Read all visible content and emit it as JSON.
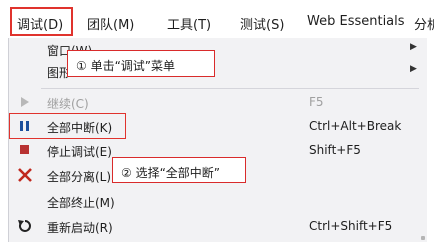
{
  "menubar": {
    "items": [
      {
        "label": "调试(D)"
      },
      {
        "label": "团队(M)"
      },
      {
        "label": "工具(T)"
      },
      {
        "label": "测试(S)"
      },
      {
        "label": "Web Essentials"
      },
      {
        "label": "分析"
      }
    ]
  },
  "menu": {
    "items": [
      {
        "label": "窗口(W)",
        "shortcut": "",
        "has_submenu": true
      },
      {
        "label": "图形",
        "shortcut": "",
        "has_submenu": true
      },
      {
        "label": "继续(C)",
        "shortcut": "F5",
        "disabled": true,
        "icon": "play-icon"
      },
      {
        "label": "全部中断(K)",
        "shortcut": "Ctrl+Alt+Break",
        "icon": "pause-icon"
      },
      {
        "label": "停止调试(E)",
        "shortcut": "Shift+F5",
        "icon": "stop-icon"
      },
      {
        "label": "全部分离(L)",
        "shortcut": "",
        "icon": "close-icon"
      },
      {
        "label": "全部终止(M)",
        "shortcut": ""
      },
      {
        "label": "重新启动(R)",
        "shortcut": "Ctrl+Shift+F5",
        "icon": "restart-icon"
      }
    ]
  },
  "callouts": {
    "step1": "① 单击“调试”菜单",
    "step2": "② 选择“全部中断”"
  },
  "colors": {
    "highlight_red": "#e0332d",
    "pause_blue": "#1c4f9c",
    "stop_red": "#b83232",
    "close_red": "#c0281e"
  }
}
